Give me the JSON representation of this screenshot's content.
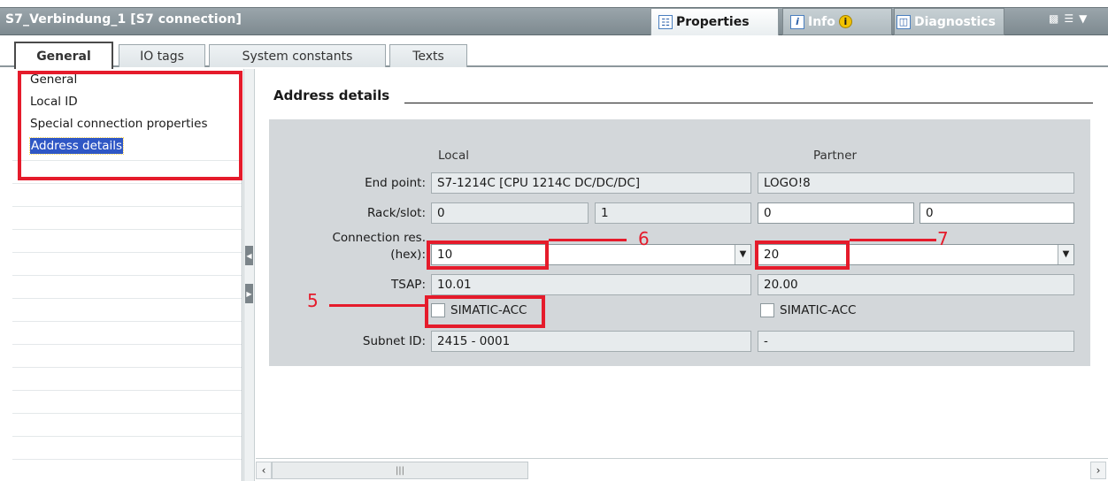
{
  "window": {
    "title": "S7_Verbindung_1 [S7 connection]",
    "controls_icon": "window-controls-icon"
  },
  "panel_tabs": {
    "properties": "Properties",
    "info": "Info",
    "diagnostics": "Diagnostics",
    "active": "Properties"
  },
  "section_tabs": {
    "items": [
      "General",
      "IO tags",
      "System constants",
      "Texts"
    ],
    "active": "General"
  },
  "nav": {
    "items": [
      "General",
      "Local ID",
      "Special connection properties",
      "Address details"
    ],
    "selected": "Address details"
  },
  "address_details": {
    "title": "Address details",
    "col_local": "Local",
    "col_partner": "Partner",
    "end_point_label": "End point:",
    "end_point_local": "S7-1214C [CPU 1214C DC/DC/DC]",
    "end_point_partner": "LOGO!8",
    "rack_slot_label": "Rack/slot:",
    "rack_local": "0",
    "slot_local": "1",
    "rack_partner": "0",
    "slot_partner": "0",
    "conn_res_label_1": "Connection res.",
    "conn_res_label_2": "(hex):",
    "conn_res_local": "10",
    "conn_res_partner": "20",
    "tsap_label": "TSAP:",
    "tsap_local": "10.01",
    "tsap_partner": "20.00",
    "simatic_acc_local": "SIMATIC-ACC",
    "simatic_acc_partner": "SIMATIC-ACC",
    "simatic_acc_local_checked": false,
    "simatic_acc_partner_checked": false,
    "subnet_label": "Subnet ID:",
    "subnet_local": "2415 - 0001",
    "subnet_partner": "-"
  },
  "annotations": {
    "callout_5": "5",
    "callout_6": "6",
    "callout_7": "7",
    "color": "#e51b2b"
  }
}
